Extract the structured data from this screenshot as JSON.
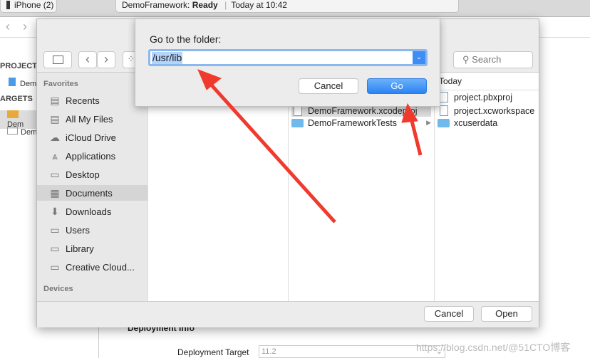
{
  "topbar": {
    "device": "iPhone (2)",
    "status_project": "DemoFramework:",
    "status_state": "Ready",
    "status_time": "Today at 10:42"
  },
  "navigator": {
    "project_header": "PROJECT",
    "project_item": "Dem",
    "targets_header": "ARGETS",
    "target_items": [
      "Dem",
      "Dem"
    ]
  },
  "finder": {
    "search_placeholder": "Search",
    "sidebar": {
      "favorites_label": "Favorites",
      "items": [
        {
          "label": "Recents",
          "icon": "recents-icon"
        },
        {
          "label": "All My Files",
          "icon": "all-files-icon"
        },
        {
          "label": "iCloud Drive",
          "icon": "cloud-icon"
        },
        {
          "label": "Applications",
          "icon": "applications-icon"
        },
        {
          "label": "Desktop",
          "icon": "desktop-icon"
        },
        {
          "label": "Documents",
          "icon": "documents-icon"
        },
        {
          "label": "Downloads",
          "icon": "downloads-icon"
        },
        {
          "label": "Users",
          "icon": "folder-icon"
        },
        {
          "label": "Library",
          "icon": "folder-icon"
        },
        {
          "label": "Creative Cloud...",
          "icon": "folder-icon"
        }
      ],
      "devices_label": "Devices"
    },
    "column2": [
      "DemoFramework.xcodeproj",
      "DemoFrameworkTests"
    ],
    "column3": {
      "header": "Today",
      "items": [
        "project.pbxproj",
        "project.xcworkspace",
        "xcuserdata"
      ]
    },
    "cancel_label": "Cancel",
    "open_label": "Open"
  },
  "goto_dialog": {
    "title": "Go to the folder:",
    "path_value": "/usr/lib",
    "cancel_label": "Cancel",
    "go_label": "Go"
  },
  "xcode_bottom": {
    "section": "Deployment Info",
    "field_label": "Deployment Target",
    "field_value": "11.2"
  },
  "watermark": "https://blog.csdn.net/@51CTO博客",
  "colors": {
    "accent": "#2a83f4",
    "arrow": "#f03a2e"
  }
}
